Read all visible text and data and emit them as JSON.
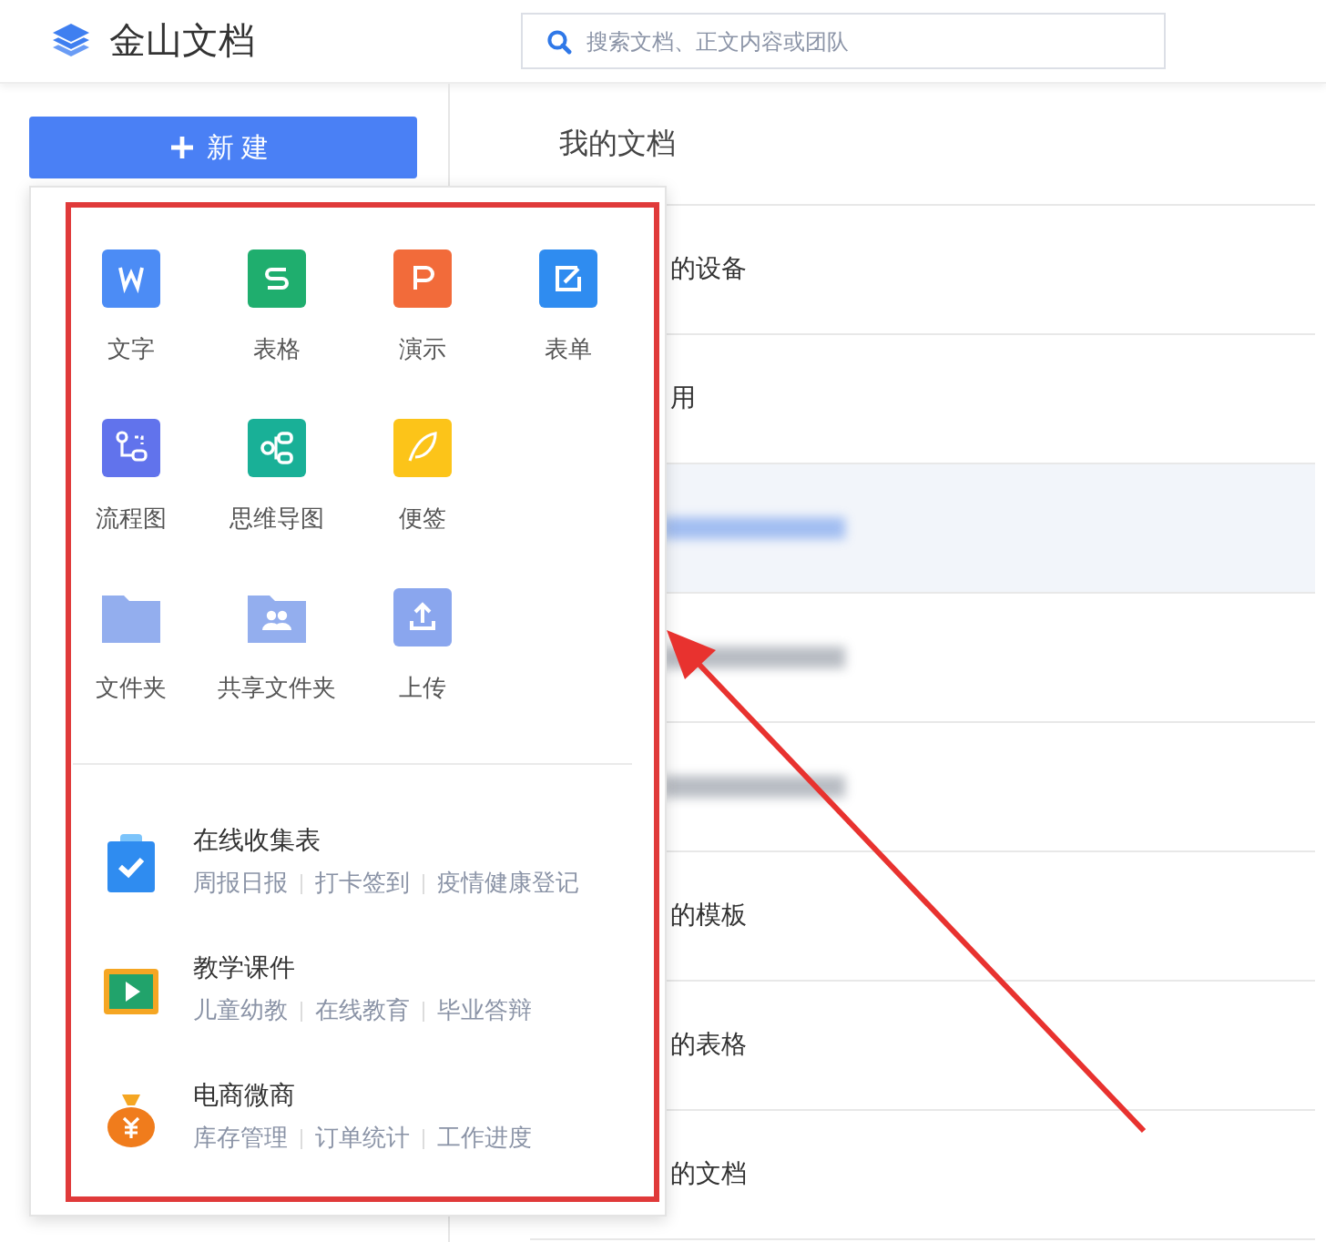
{
  "header": {
    "logo_text": "金山文档",
    "search": {
      "placeholder": "搜索文档、正文内容或团队"
    }
  },
  "new_button": {
    "label": "新建"
  },
  "page_title": "我的文档",
  "rows": [
    {
      "kind": "text",
      "label": "的设备",
      "selected": false
    },
    {
      "kind": "text",
      "label": "用",
      "selected": false
    },
    {
      "kind": "redacted",
      "selected": true
    },
    {
      "kind": "redacted",
      "selected": false
    },
    {
      "kind": "redacted",
      "selected": false
    },
    {
      "kind": "text",
      "label": "的模板",
      "selected": false
    },
    {
      "kind": "text",
      "label": "的表格",
      "selected": false
    },
    {
      "kind": "text",
      "label": "的文档",
      "selected": false
    }
  ],
  "popup": {
    "create_items": [
      {
        "kind": "word",
        "label": "文字"
      },
      {
        "kind": "sheet",
        "label": "表格"
      },
      {
        "kind": "slides",
        "label": "演示"
      },
      {
        "kind": "form",
        "label": "表单"
      },
      {
        "kind": "flowchart",
        "label": "流程图"
      },
      {
        "kind": "mindmap",
        "label": "思维导图"
      },
      {
        "kind": "note",
        "label": "便签"
      },
      {
        "kind": "blank"
      },
      {
        "kind": "folder",
        "label": "文件夹"
      },
      {
        "kind": "shared_folder",
        "label": "共享文件夹"
      },
      {
        "kind": "upload",
        "label": "上传"
      }
    ],
    "templates": [
      {
        "kind": "collect",
        "title": "在线收集表",
        "tags": [
          "周报日报",
          "打卡签到",
          "疫情健康登记"
        ]
      },
      {
        "kind": "courseware",
        "title": "教学课件",
        "tags": [
          "儿童幼教",
          "在线教育",
          "毕业答辩"
        ]
      },
      {
        "kind": "ecommerce",
        "title": "电商微商",
        "tags": [
          "库存管理",
          "订单统计",
          "工作进度"
        ]
      }
    ]
  },
  "annotation": {
    "frame": true,
    "arrow": true
  }
}
